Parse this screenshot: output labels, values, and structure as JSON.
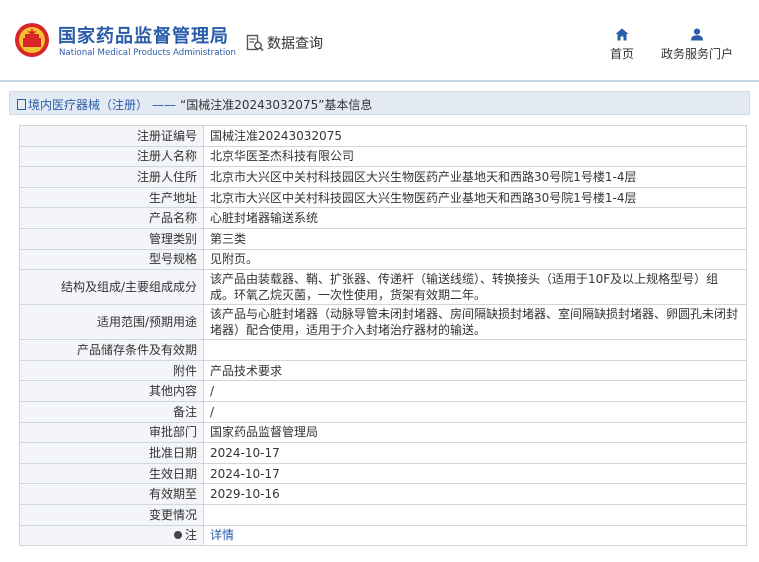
{
  "header": {
    "logo_cn": "国家药品监督管理局",
    "logo_en": "National Medical Products Administration",
    "section_title": "数据查询",
    "nav": [
      {
        "label": "首页",
        "icon": "home-icon"
      },
      {
        "label": "政务服务门户",
        "icon": "user-icon"
      }
    ]
  },
  "breadcrumb": {
    "category": "境内医疗器械（注册）",
    "separator": "——",
    "title": "“国械注准20243032075”基本信息"
  },
  "table": {
    "rows": [
      {
        "label": "注册证编号",
        "value": "国械注准20243032075"
      },
      {
        "label": "注册人名称",
        "value": "北京华医圣杰科技有限公司"
      },
      {
        "label": "注册人住所",
        "value": "北京市大兴区中关村科技园区大兴生物医药产业基地天和西路30号院1号楼1-4层"
      },
      {
        "label": "生产地址",
        "value": "北京市大兴区中关村科技园区大兴生物医药产业基地天和西路30号院1号楼1-4层"
      },
      {
        "label": "产品名称",
        "value": "心脏封堵器输送系统"
      },
      {
        "label": "管理类别",
        "value": "第三类"
      },
      {
        "label": "型号规格",
        "value": "见附页。"
      },
      {
        "label": "结构及组成/主要组成成分",
        "value": "该产品由装载器、鞘、扩张器、传递杆（输送线缆）、转换接头（适用于10F及以上规格型号）组成。环氧乙烷灭菌，一次性使用，货架有效期二年。"
      },
      {
        "label": "适用范围/预期用途",
        "value": "该产品与心脏封堵器（动脉导管未闭封堵器、房间隔缺损封堵器、室间隔缺损封堵器、卵圆孔未闭封堵器）配合使用，适用于介入封堵治疗器材的输送。"
      },
      {
        "label": "产品储存条件及有效期",
        "value": ""
      },
      {
        "label": "附件",
        "value": "产品技术要求"
      },
      {
        "label": "其他内容",
        "value": "/"
      },
      {
        "label": "备注",
        "value": "/"
      },
      {
        "label": "审批部门",
        "value": "国家药品监督管理局"
      },
      {
        "label": "批准日期",
        "value": "2024-10-17"
      },
      {
        "label": "生效日期",
        "value": "2024-10-17"
      },
      {
        "label": "有效期至",
        "value": "2029-10-16"
      },
      {
        "label": "变更情况",
        "value": ""
      },
      {
        "label": "注",
        "value": "详情"
      }
    ]
  },
  "colors": {
    "brand_blue": "#2a5caa",
    "label_bg": "#f3f5f8",
    "border": "#cfd6df",
    "crumb_bg": "#e4eaf3"
  }
}
